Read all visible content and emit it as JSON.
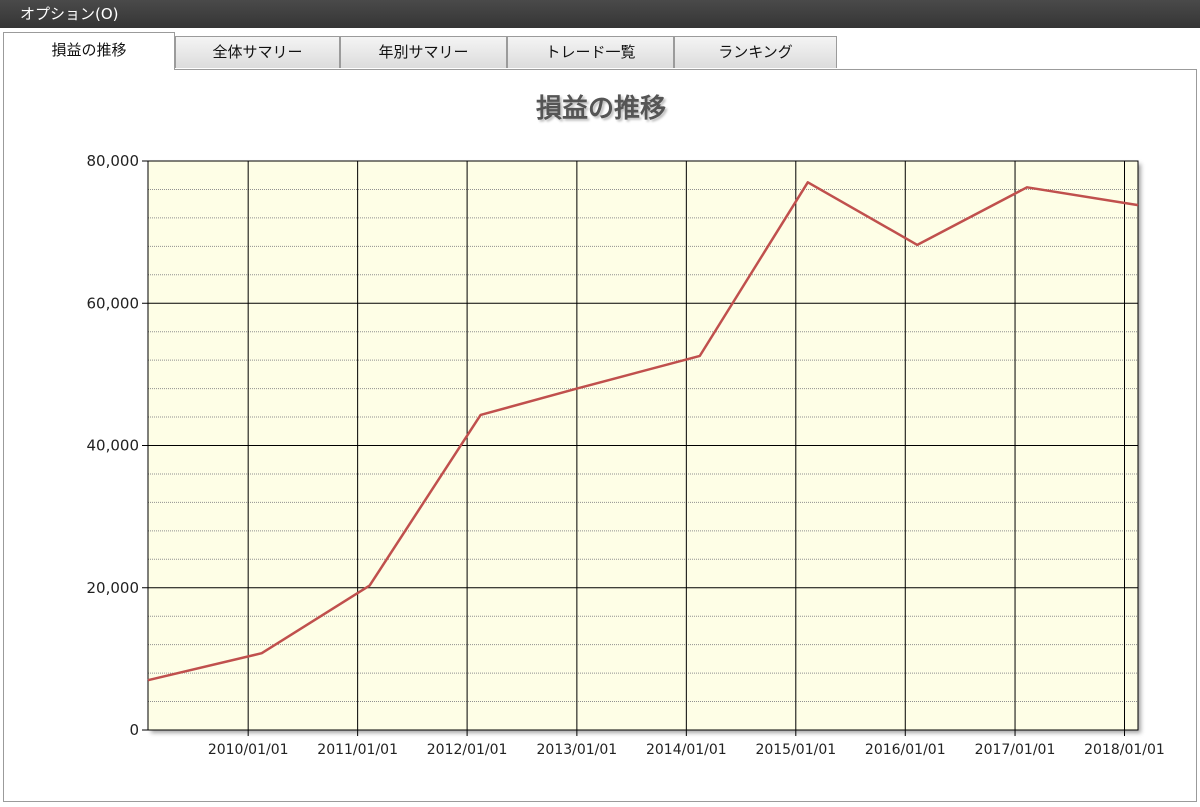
{
  "menu": {
    "options_label": "オプション(O)"
  },
  "tabs": [
    {
      "label": "損益の推移",
      "active": true
    },
    {
      "label": "全体サマリー",
      "active": false
    },
    {
      "label": "年別サマリー",
      "active": false
    },
    {
      "label": "トレード一覧",
      "active": false
    },
    {
      "label": "ランキング",
      "active": false
    }
  ],
  "colors": {
    "plot_background": "#fefee6",
    "line": "#c0504d",
    "grid_major": "#000000",
    "grid_minor": "#909090"
  },
  "chart_data": {
    "type": "line",
    "title": "損益の推移",
    "xlabel": "",
    "ylabel": "",
    "x_tick_labels": [
      "2010/01/01",
      "2011/01/01",
      "2012/01/01",
      "2013/01/01",
      "2014/01/01",
      "2015/01/01",
      "2016/01/01",
      "2017/01/01",
      "2018/01/01"
    ],
    "y_tick_labels": [
      "0",
      "20,000",
      "40,000",
      "60,000",
      "80,000"
    ],
    "ylim": [
      0,
      80000
    ],
    "xlim": [
      "2009/02/01",
      "2018/02/15"
    ],
    "grid": true,
    "legend": "none",
    "series": [
      {
        "points": [
          {
            "x": "2009/02/01",
            "y": 7000
          },
          {
            "x": "2010/02/15",
            "y": 10800
          },
          {
            "x": "2011/02/10",
            "y": 20300
          },
          {
            "x": "2012/02/15",
            "y": 44300
          },
          {
            "x": "2013/01/01",
            "y": 48000
          },
          {
            "x": "2014/02/15",
            "y": 52600
          },
          {
            "x": "2015/02/10",
            "y": 77000
          },
          {
            "x": "2016/02/10",
            "y": 68200
          },
          {
            "x": "2017/02/10",
            "y": 76300
          },
          {
            "x": "2018/02/15",
            "y": 73800
          }
        ]
      }
    ]
  }
}
